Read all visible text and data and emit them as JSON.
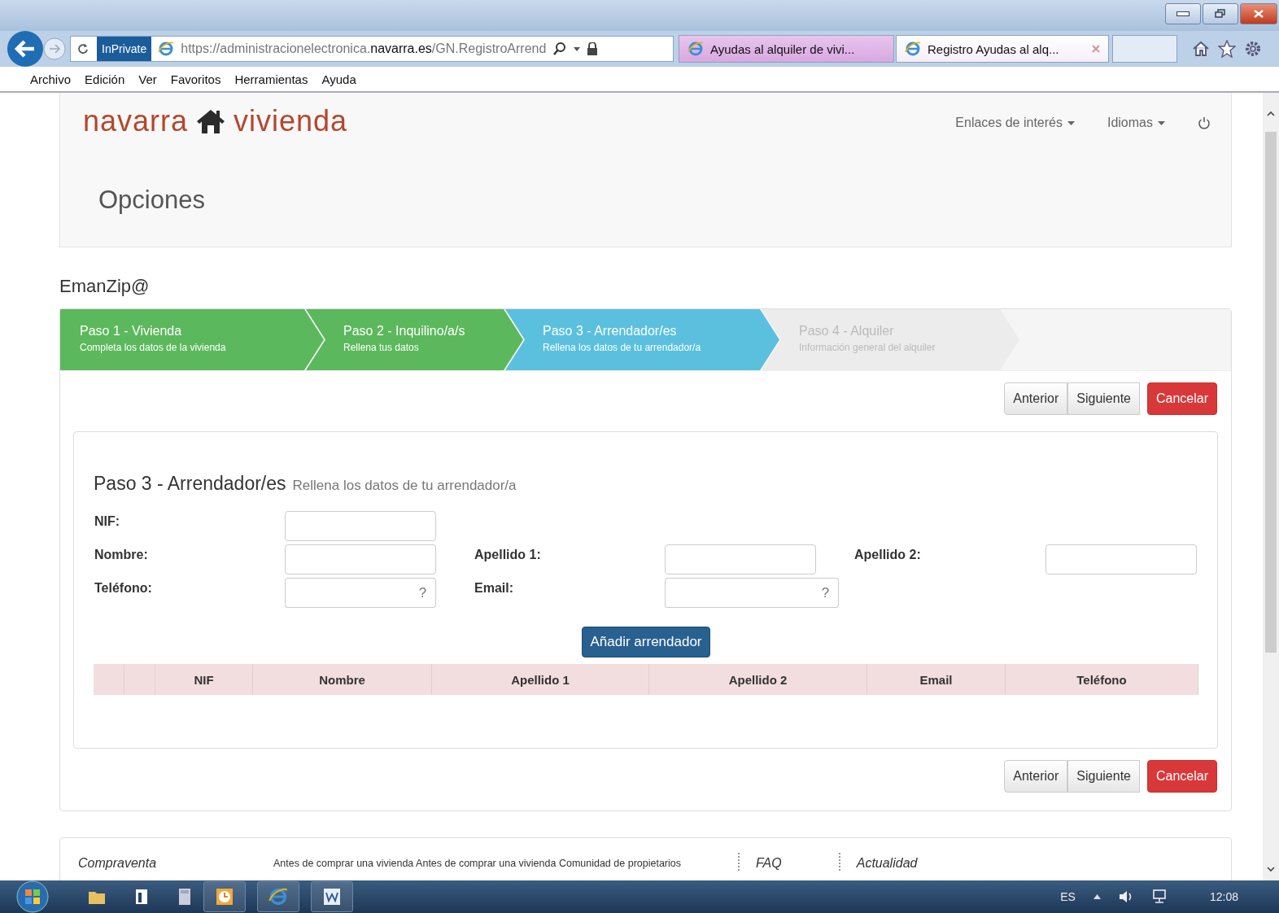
{
  "browser": {
    "inprivate": "InPrivate",
    "url": "https://administracionelectronica.**navarra.es**/GN.RegistroArrend",
    "tabs": [
      {
        "title": "Ayudas al alquiler de vivi...",
        "selected": false
      },
      {
        "title": "Registro Ayudas al alq...",
        "selected": true
      }
    ],
    "menu": [
      "Archivo",
      "Edición",
      "Ver",
      "Favoritos",
      "Herramientas",
      "Ayuda"
    ]
  },
  "header": {
    "logo_left": "navarra",
    "logo_right": "vivienda",
    "links": [
      "Enlaces de interés",
      "Idiomas"
    ],
    "heading": "Opciones"
  },
  "app_title": "EmanZip@",
  "steps": [
    {
      "title": "Paso 1 - Vivienda",
      "subtitle": "Completa los datos de la vivienda",
      "done": true,
      "selected": false
    },
    {
      "title": "Paso 2 - Inquilino/a/s",
      "subtitle": "Rellena tus datos",
      "done": true,
      "selected": false
    },
    {
      "title": "Paso 3 - Arrendador/es",
      "subtitle": "Rellena los datos de tu arrendador/a",
      "done": false,
      "selected": true
    },
    {
      "title": "Paso 4 - Alquiler",
      "subtitle": "Información general del alquiler",
      "done": false,
      "selected": false
    }
  ],
  "nav_buttons_top": [
    {
      "label": "Anterior",
      "kind": "default"
    },
    {
      "label": "Siguiente",
      "kind": "default"
    },
    {
      "label": "Cancelar",
      "kind": "danger"
    }
  ],
  "section": {
    "title": "Paso 3 - Arrendador/es",
    "subtitle": "Rellena los datos de tu arrendador/a"
  },
  "form_rows": [
    [
      {
        "label": "NIF:",
        "kind": "plain"
      }
    ],
    [
      {
        "label": "Nombre:",
        "kind": "plain"
      },
      {
        "label": "Apellido 1:",
        "kind": "plain"
      },
      {
        "label": "Apellido 2:",
        "kind": "plain"
      }
    ],
    [
      {
        "label": "Teléfono:",
        "kind": "help",
        "help": "?"
      },
      {
        "label": "Email:",
        "kind": "wide",
        "help": "?"
      }
    ]
  ],
  "add_button": "Añadir arrendador",
  "table": {
    "columns": [
      "NIF",
      "Nombre",
      "Apellido 1",
      "Apellido 2",
      "Email",
      "Teléfono"
    ]
  },
  "nav_buttons_bottom": [
    {
      "label": "Anterior",
      "kind": "default"
    },
    {
      "label": "Siguiente",
      "kind": "default"
    },
    {
      "label": "Cancelar",
      "kind": "danger"
    }
  ],
  "footer": [
    {
      "text": "Compraventa",
      "kind": "title"
    },
    {
      "text": "Antes de comprar una vivienda Antes de comprar una vivienda Comunidad de propietarios",
      "kind": "text"
    },
    {
      "text": "FAQ",
      "kind": "title"
    },
    {
      "text": "Actualidad",
      "kind": "title"
    }
  ],
  "taskbar": {
    "language": "ES",
    "clock": "12:08"
  }
}
